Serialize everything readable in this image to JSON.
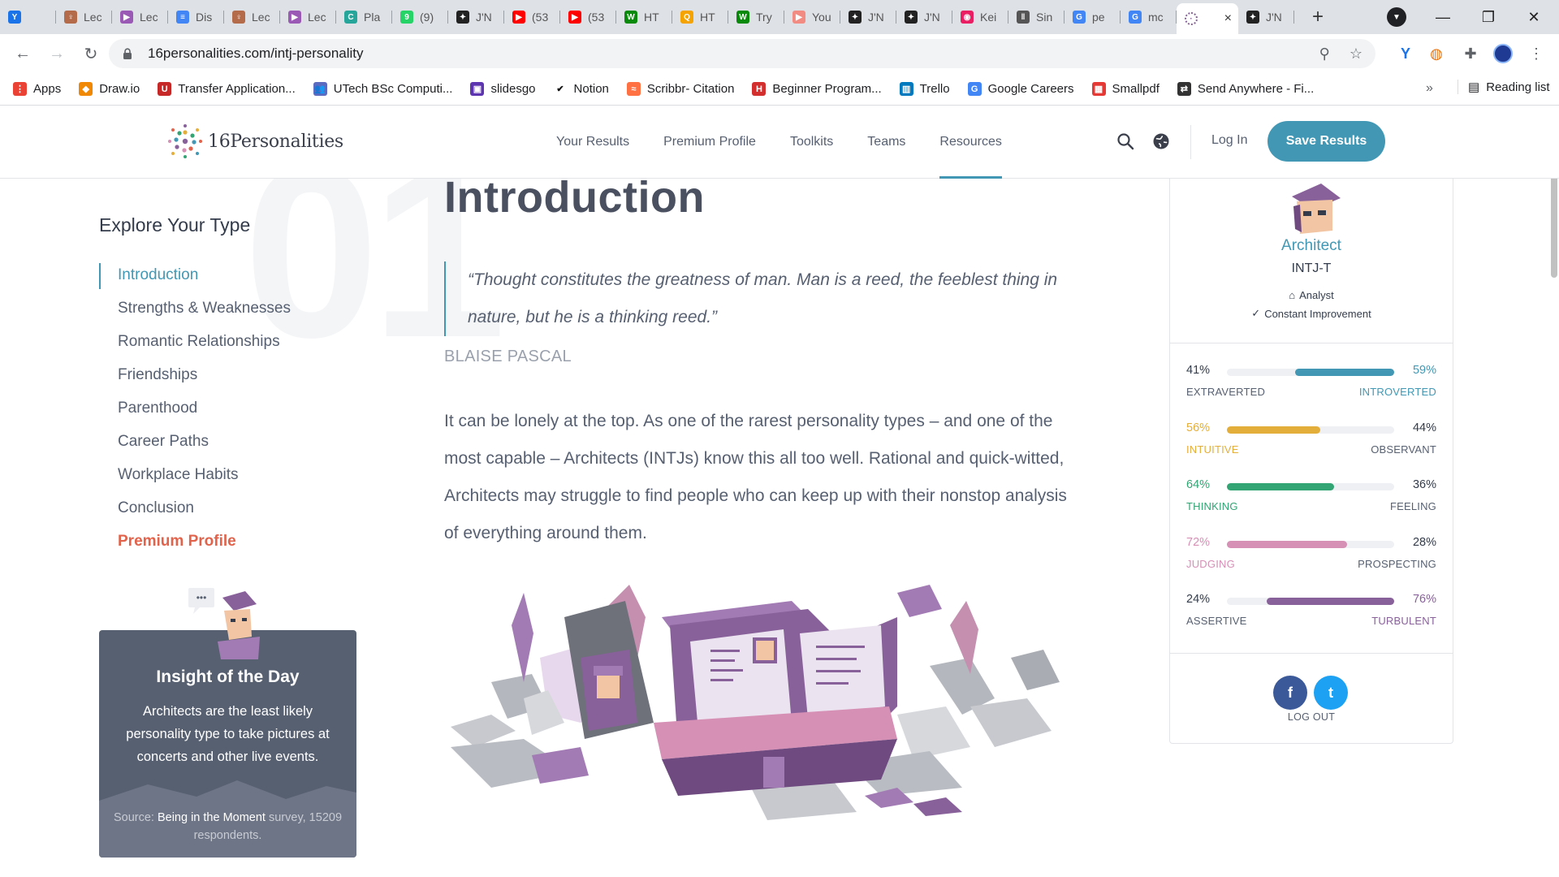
{
  "browser": {
    "tabs": [
      {
        "label": "",
        "color": "#1a73e8",
        "glyph": "Y"
      },
      {
        "label": "Lec",
        "color": "#b36b4a",
        "glyph": "♀"
      },
      {
        "label": "Lec",
        "color": "#9b59b6",
        "glyph": "▶"
      },
      {
        "label": "Dis",
        "color": "#4285f4",
        "glyph": "≡"
      },
      {
        "label": "Lec",
        "color": "#b36b4a",
        "glyph": "♀"
      },
      {
        "label": "Lec",
        "color": "#9b59b6",
        "glyph": "▶"
      },
      {
        "label": "Pla",
        "color": "#26a69a",
        "glyph": "C"
      },
      {
        "label": "(9)",
        "color": "#25d366",
        "glyph": "9"
      },
      {
        "label": "J'N",
        "color": "#222222",
        "glyph": "✦"
      },
      {
        "label": "(53",
        "color": "#ff0000",
        "glyph": "▶"
      },
      {
        "label": "(53",
        "color": "#ff0000",
        "glyph": "▶"
      },
      {
        "label": "HT",
        "color": "#0a8a0a",
        "glyph": "W"
      },
      {
        "label": "HT",
        "color": "#f4a300",
        "glyph": "Q"
      },
      {
        "label": "Try",
        "color": "#0a8a0a",
        "glyph": "W"
      },
      {
        "label": "You",
        "color": "#f28b82",
        "glyph": "▶"
      },
      {
        "label": "J'N",
        "color": "#222222",
        "glyph": "✦"
      },
      {
        "label": "J'N",
        "color": "#222222",
        "glyph": "✦"
      },
      {
        "label": "Kei",
        "color": "#e91e63",
        "glyph": "◉"
      },
      {
        "label": "Sin",
        "color": "#555555",
        "glyph": "‖"
      },
      {
        "label": "pe",
        "color": "#4285f4",
        "glyph": "G"
      },
      {
        "label": "mc",
        "color": "#4285f4",
        "glyph": "G"
      }
    ],
    "active_tab": {
      "label": "",
      "close": "×"
    },
    "trailing_tab": {
      "label": "J'N",
      "color": "#222222",
      "glyph": "✦"
    },
    "new_tab": "+",
    "window_controls": [
      "—",
      "❐",
      "✕"
    ],
    "url": "16personalities.com/intj-personality",
    "bookmarks": [
      {
        "label": "Apps",
        "color": "#ea4335",
        "glyph": "⋮"
      },
      {
        "label": "Draw.io",
        "color": "#f08705",
        "glyph": "◆"
      },
      {
        "label": "Transfer Application...",
        "color": "#c62828",
        "glyph": "U"
      },
      {
        "label": "UTech BSc Computi...",
        "color": "#5c6bc0",
        "glyph": "👥"
      },
      {
        "label": "slidesgo",
        "color": "#5e35b1",
        "glyph": "▣"
      },
      {
        "label": "Notion",
        "color": "#ffffff",
        "glyph": "✔"
      },
      {
        "label": "Scribbr- Citation",
        "color": "#ff7043",
        "glyph": "≈"
      },
      {
        "label": "Beginner Program...",
        "color": "#d32f2f",
        "glyph": "H"
      },
      {
        "label": "Trello",
        "color": "#0079bf",
        "glyph": "▥"
      },
      {
        "label": "Google Careers",
        "color": "#4285f4",
        "glyph": "G"
      },
      {
        "label": "Smallpdf",
        "color": "#e53935",
        "glyph": "▦"
      },
      {
        "label": "Send Anywhere - Fi...",
        "color": "#333333",
        "glyph": "⇄"
      }
    ],
    "bookmarks_more": "»",
    "reading_list": "Reading list"
  },
  "site": {
    "logo_text": "16Personalities",
    "nav": [
      "Your Results",
      "Premium Profile",
      "Toolkits",
      "Teams",
      "Resources"
    ],
    "login": "Log In",
    "save_button": "Save Results",
    "accent": "#4298b4"
  },
  "sidebar": {
    "bg_number": "01",
    "heading": "Explore Your Type",
    "items": [
      "Introduction",
      "Strengths & Weaknesses",
      "Romantic Relationships",
      "Friendships",
      "Parenthood",
      "Career Paths",
      "Workplace Habits",
      "Conclusion",
      "Premium Profile"
    ],
    "insight": {
      "bubble": "•••",
      "title": "Insight of the Day",
      "body": "Architects are the least likely personality type to take pictures at concerts and other live events.",
      "source_prefix": "Source: ",
      "source_link": "Being in the Moment",
      "source_suffix": " survey, 15209 respondents."
    }
  },
  "main": {
    "heading": "Introduction",
    "quote": "“Thought constitutes the greatness of man. Man is a reed, the feeblest thing in nature, but he is a thinking reed.”",
    "quote_author": "BLAISE PASCAL",
    "paragraph": "It can be lonely at the top. As one of the rarest personality types – and one of the most capable – Architects (INTJs) know this all too well. Rational and quick-witted, Architects may struggle to find people who can keep up with their nonstop analysis of everything around them."
  },
  "profile_card": {
    "type_name": "Architect",
    "type_code": "INTJ-T",
    "role": "Analyst",
    "strategy": "Constant Improvement",
    "traits": [
      {
        "left_pct": "41%",
        "right_pct": "59%",
        "left_label": "EXTRAVERTED",
        "right_label": "INTROVERTED",
        "dominant": "right",
        "value": 0.59,
        "color": "#4298b4"
      },
      {
        "left_pct": "56%",
        "right_pct": "44%",
        "left_label": "INTUITIVE",
        "right_label": "OBSERVANT",
        "dominant": "left",
        "value": 0.56,
        "color": "#e4ae3a"
      },
      {
        "left_pct": "64%",
        "right_pct": "36%",
        "left_label": "THINKING",
        "right_label": "FEELING",
        "dominant": "left",
        "value": 0.64,
        "color": "#33a474"
      },
      {
        "left_pct": "72%",
        "right_pct": "28%",
        "left_label": "JUDGING",
        "right_label": "PROSPECTING",
        "dominant": "left",
        "value": 0.72,
        "color": "#d68fb5"
      },
      {
        "left_pct": "24%",
        "right_pct": "76%",
        "left_label": "ASSERTIVE",
        "right_label": "TURBULENT",
        "dominant": "right",
        "value": 0.76,
        "color": "#88619a"
      }
    ],
    "social": [
      {
        "icon": "f",
        "color": "#3b5998"
      },
      {
        "icon": "t",
        "color": "#1da1f2"
      }
    ],
    "logout": "LOG OUT"
  }
}
